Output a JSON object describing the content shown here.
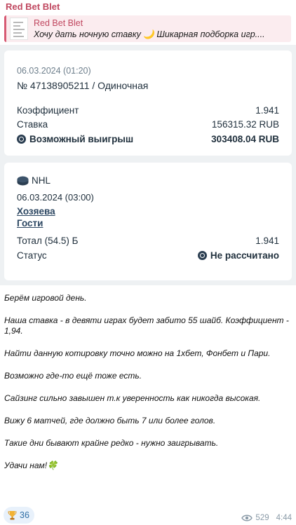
{
  "channel": {
    "sender_name": "Red Bet Blet"
  },
  "reply": {
    "title": "Red Bet Blet",
    "preview": "Хочу дать ночную ставку 🌙  Шикарная подборка игр...."
  },
  "bet_card": {
    "date": "06.03.2024 (01:20)",
    "number": "№ 47138905211 / Одиночная",
    "coef_label": "Коэффициент",
    "coef_value": "1.941",
    "stake_label": "Ставка",
    "stake_value": "156315.32 RUB",
    "win_label": "Возможный выигрыш",
    "win_value": "303408.04 RUB"
  },
  "event_card": {
    "league": "NHL",
    "date": "06.03.2024 (03:00)",
    "home": "Хозяева",
    "away": "Гости",
    "market_label": "Тотал (54.5) Б",
    "market_value": "1.941",
    "status_label": "Статус",
    "status_value": "Не рассчитано"
  },
  "message": {
    "paragraphs": [
      "Берём игровой день.",
      "Наша ставка - в девяти играх будет забито 55 шайб. Коэффициент - 1,94.",
      "Найти данную котировку точно можно на 1хбет, Фонбет и Пари.",
      "Возможно где-то ещё тоже есть.",
      "Сайзинг сильно завышен т.к уверенность как никогда высокая.",
      "Вижу 6 матчей, где должно быть 7 или более голов.",
      "Такие дни бывают крайне редко - нужно заигрывать.",
      "Удачи нам!🍀"
    ]
  },
  "reaction": {
    "emoji_icon": "trophy-icon",
    "count": "36"
  },
  "meta": {
    "views": "529",
    "time": "4:44"
  },
  "colors": {
    "accent": "#c0475f",
    "reply_bg": "#fbecef",
    "media_bg": "#eef1f3",
    "text_dark": "#20303d",
    "reaction_bg": "#e8f1fb"
  }
}
